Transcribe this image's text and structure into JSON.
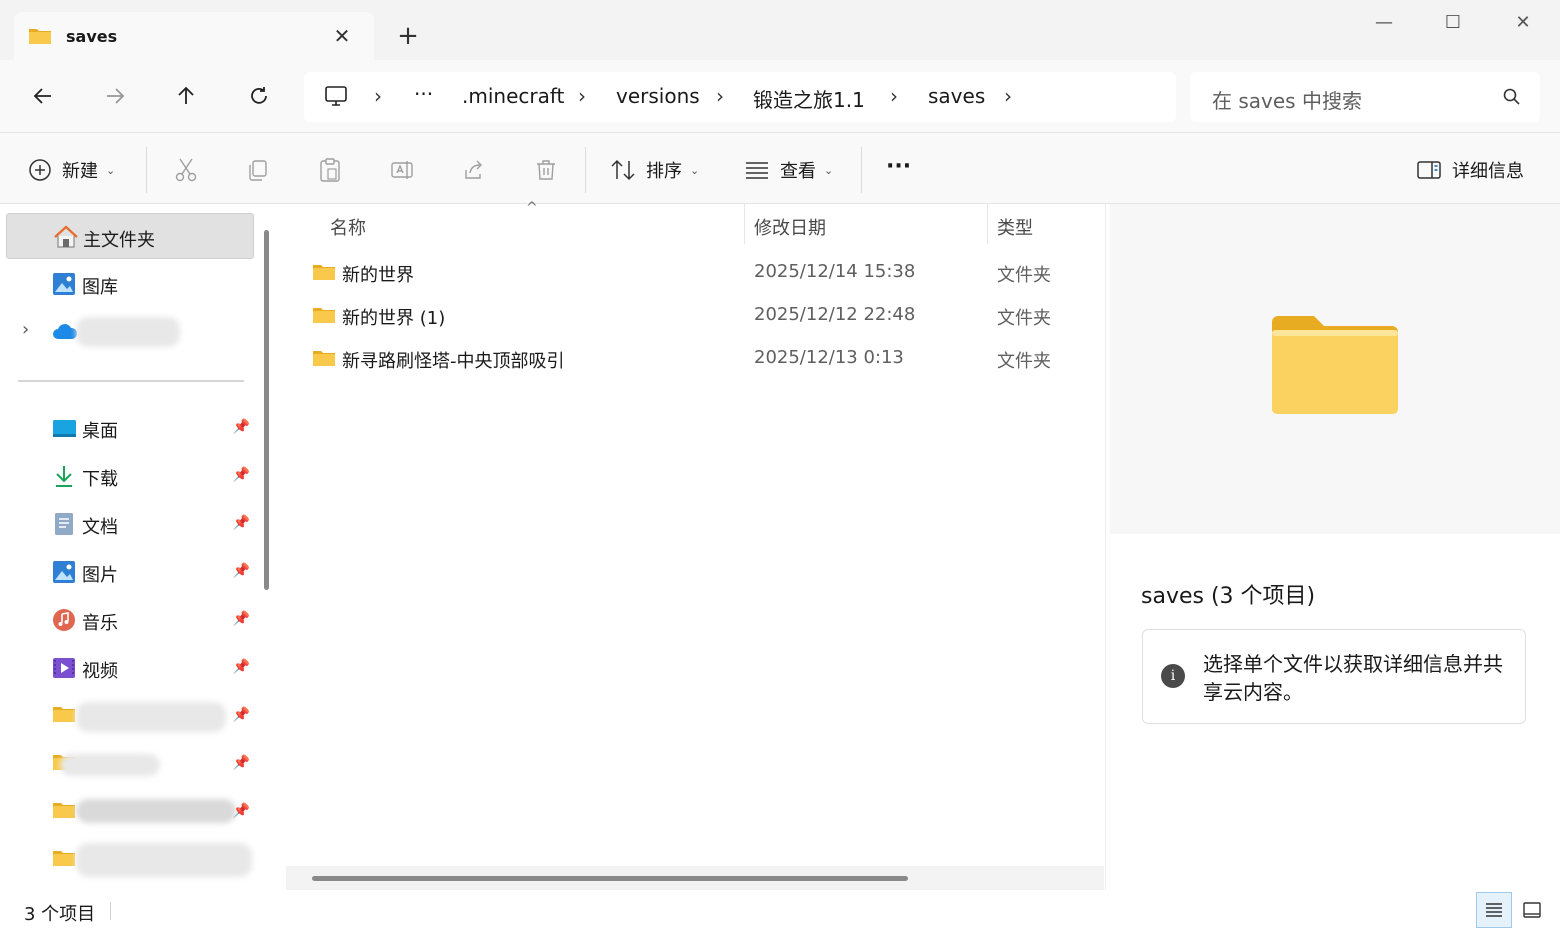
{
  "tab": {
    "title": "saves",
    "close": "✕",
    "new": "+"
  },
  "window": {
    "minimize": "—",
    "maximize": "☐",
    "close": "✕"
  },
  "breadcrumb": {
    "more": "···",
    "items": [
      ".minecraft",
      "versions",
      "锻造之旅1.1",
      "saves"
    ],
    "sep": "›"
  },
  "search": {
    "placeholder": "在 saves 中搜索"
  },
  "commands": {
    "new_label": "新建",
    "sort_label": "排序",
    "view_label": "查看",
    "more": "···",
    "details_label": "详细信息"
  },
  "sidebar": {
    "home": "主文件夹",
    "gallery": "图库",
    "pinned": [
      {
        "label": "桌面"
      },
      {
        "label": "下载"
      },
      {
        "label": "文档"
      },
      {
        "label": "图片"
      },
      {
        "label": "音乐"
      },
      {
        "label": "视频"
      }
    ],
    "pin": "📌"
  },
  "columns": {
    "name": "名称",
    "date": "修改日期",
    "type": "类型"
  },
  "files": [
    {
      "name": "新的世界",
      "date": "2025/12/14 15:38",
      "type": "文件夹"
    },
    {
      "name": "新的世界 (1)",
      "date": "2025/12/12 22:48",
      "type": "文件夹"
    },
    {
      "name": "新寻路刷怪塔-中央顶部吸引",
      "date": "2025/12/13 0:13",
      "type": "文件夹"
    }
  ],
  "details": {
    "title": "saves (3 个项目)",
    "info": "选择单个文件以获取详细信息并共享云内容。"
  },
  "status": {
    "count": "3 个项目"
  },
  "colors": {
    "folder": "#f8c94a",
    "folder_dark": "#e8ac22",
    "accent": "#0067c0"
  }
}
